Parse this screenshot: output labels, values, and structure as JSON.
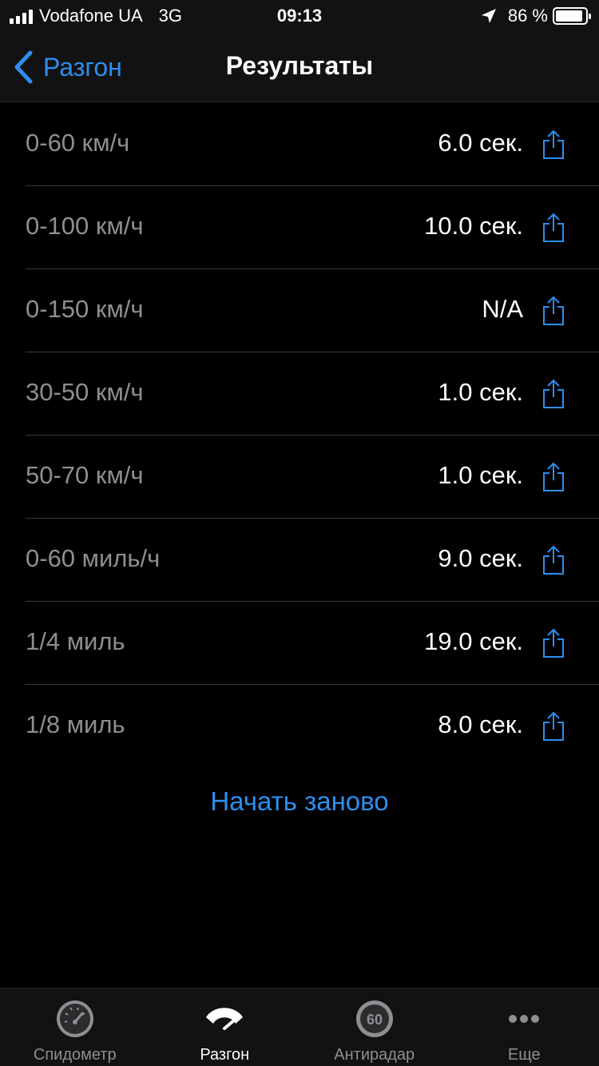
{
  "status_bar": {
    "carrier": "Vodafone UA",
    "network": "3G",
    "time": "09:13",
    "battery_percent": "86 %",
    "icons": [
      "signal-icon",
      "location-arrow-icon",
      "battery-icon"
    ]
  },
  "nav": {
    "back_label": "Разгон",
    "title": "Результаты"
  },
  "results": [
    {
      "label": "0-60 км/ч",
      "value": "6.0 сек."
    },
    {
      "label": "0-100 км/ч",
      "value": "10.0 сек."
    },
    {
      "label": "0-150 км/ч",
      "value": "N/A"
    },
    {
      "label": "30-50 км/ч",
      "value": "1.0 сек."
    },
    {
      "label": "50-70 км/ч",
      "value": "1.0 сек."
    },
    {
      "label": "0-60 миль/ч",
      "value": "9.0 сек."
    },
    {
      "label": "1/4 миль",
      "value": "19.0 сек."
    },
    {
      "label": "1/8 миль",
      "value": "8.0 сек."
    }
  ],
  "restart_label": "Начать заново",
  "tabs": [
    {
      "label": "Спидометр",
      "icon": "speedometer-icon",
      "active": false
    },
    {
      "label": "Разгон",
      "icon": "acceleration-gauge-icon",
      "active": true
    },
    {
      "label": "Антирадар",
      "icon": "speed-limit-sign-icon",
      "active": false
    },
    {
      "label": "Еще",
      "icon": "more-dots-icon",
      "active": false
    }
  ],
  "speed_limit_sign_text": "60",
  "colors": {
    "accent": "#2d8ff0",
    "background": "#000000",
    "bar_background": "#121212",
    "secondary_text": "#8e8e93",
    "separator": "#3a3a3c"
  }
}
